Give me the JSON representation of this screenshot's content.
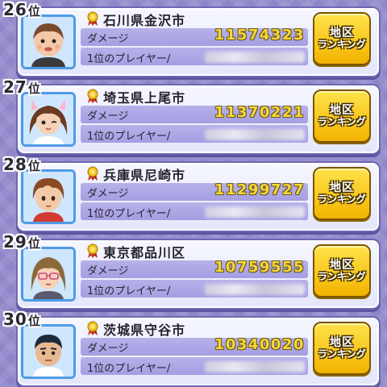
{
  "rank_suffix": "位",
  "labels": {
    "damage": "ダメージ",
    "top_player": "1位のプレイヤー/",
    "button_line1": "地区",
    "button_line2": "ランキング"
  },
  "entries": [
    {
      "rank": "26",
      "region": "石川県金沢市",
      "damage": "11574323",
      "avatar": "boy-round-face-brown-hair"
    },
    {
      "rank": "27",
      "region": "埼玉県上尾市",
      "damage": "11370221",
      "avatar": "girl-cat-ears-winking"
    },
    {
      "rank": "28",
      "region": "兵庫県尼崎市",
      "damage": "11299727",
      "avatar": "boy-brown-hair-red-shirt"
    },
    {
      "rank": "29",
      "region": "東京都品川区",
      "damage": "10759555",
      "avatar": "woman-glasses-pink"
    },
    {
      "rank": "30",
      "region": "茨城県守谷市",
      "damage": "10340020",
      "avatar": "man-dark-hair-white-shirt"
    }
  ]
}
